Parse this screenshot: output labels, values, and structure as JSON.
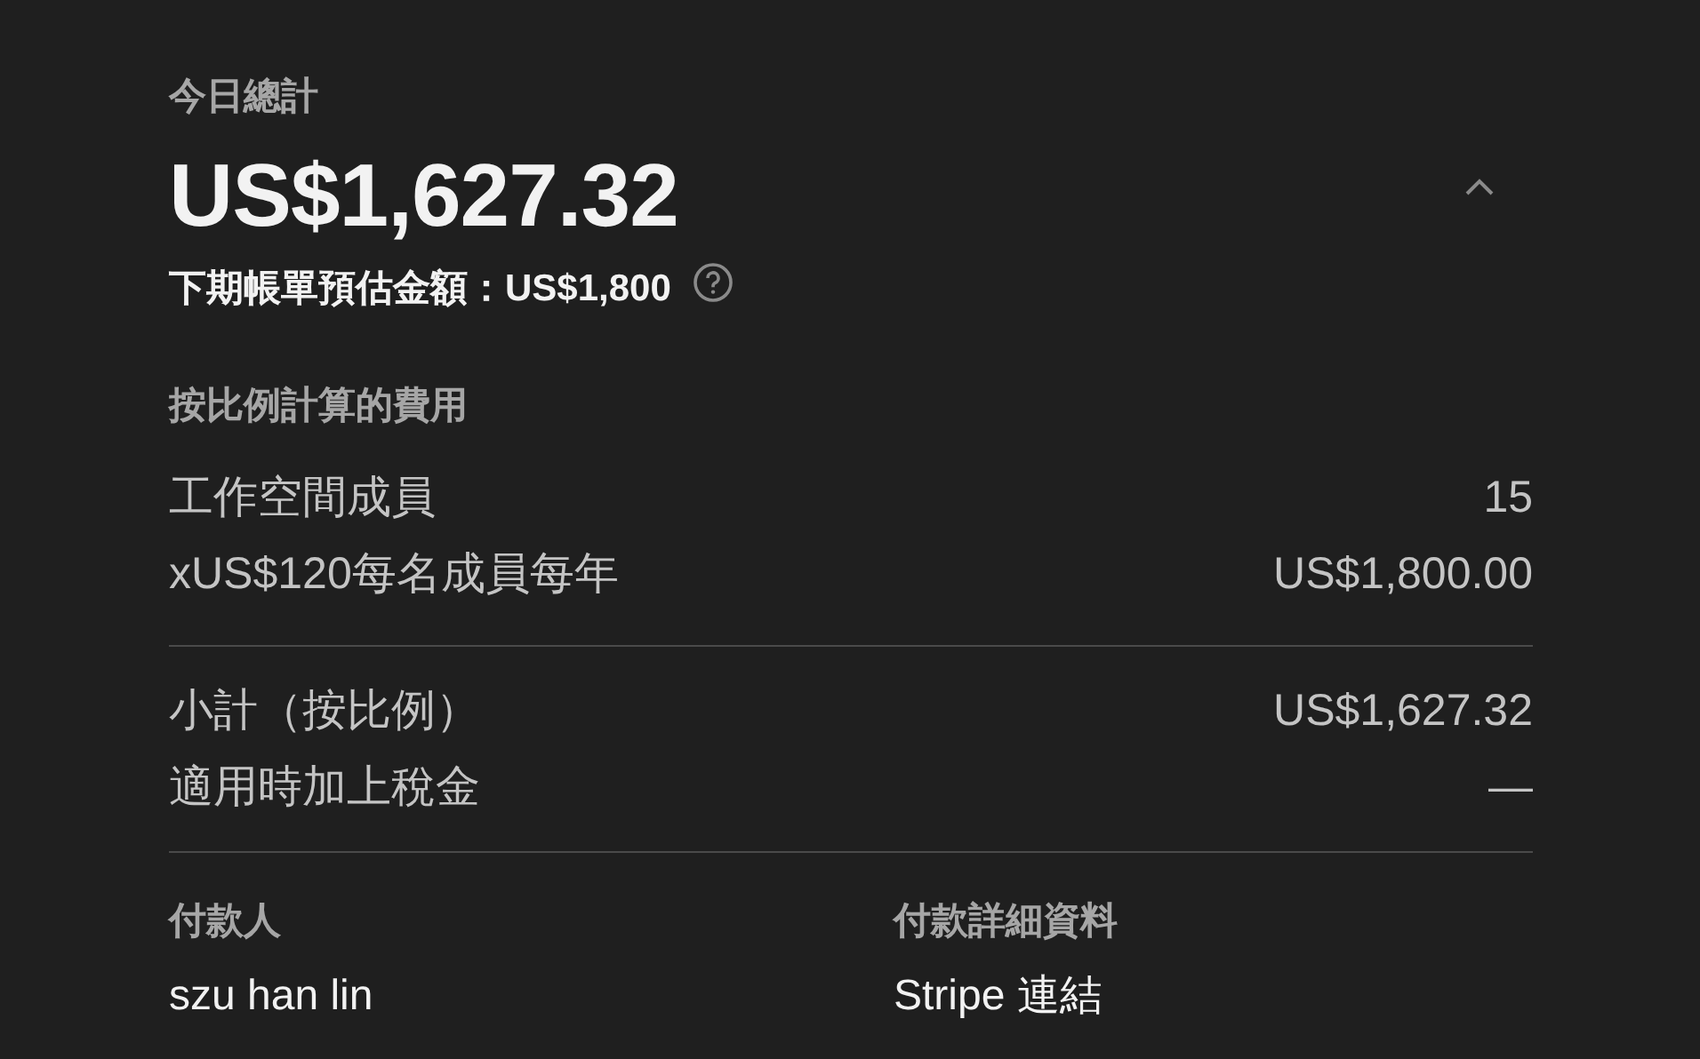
{
  "summary": {
    "label": "今日總計",
    "total": "US$1,627.32",
    "expanded": true,
    "estimate": "下期帳單預估金額：US$1,800"
  },
  "section_title": "按比例計算的費用",
  "line_items": [
    {
      "label": "工作空間成員",
      "value": "15"
    },
    {
      "label": "xUS$120每名成員每年",
      "value": "US$1,800.00"
    }
  ],
  "totals": [
    {
      "label": "小計（按比例）",
      "value": "US$1,627.32"
    },
    {
      "label": "適用時加上稅金",
      "value": "—"
    }
  ],
  "payment": [
    {
      "label": "付款人",
      "value": "szu han lin"
    },
    {
      "label": "付款詳細資料",
      "value": "Stripe 連結"
    }
  ]
}
